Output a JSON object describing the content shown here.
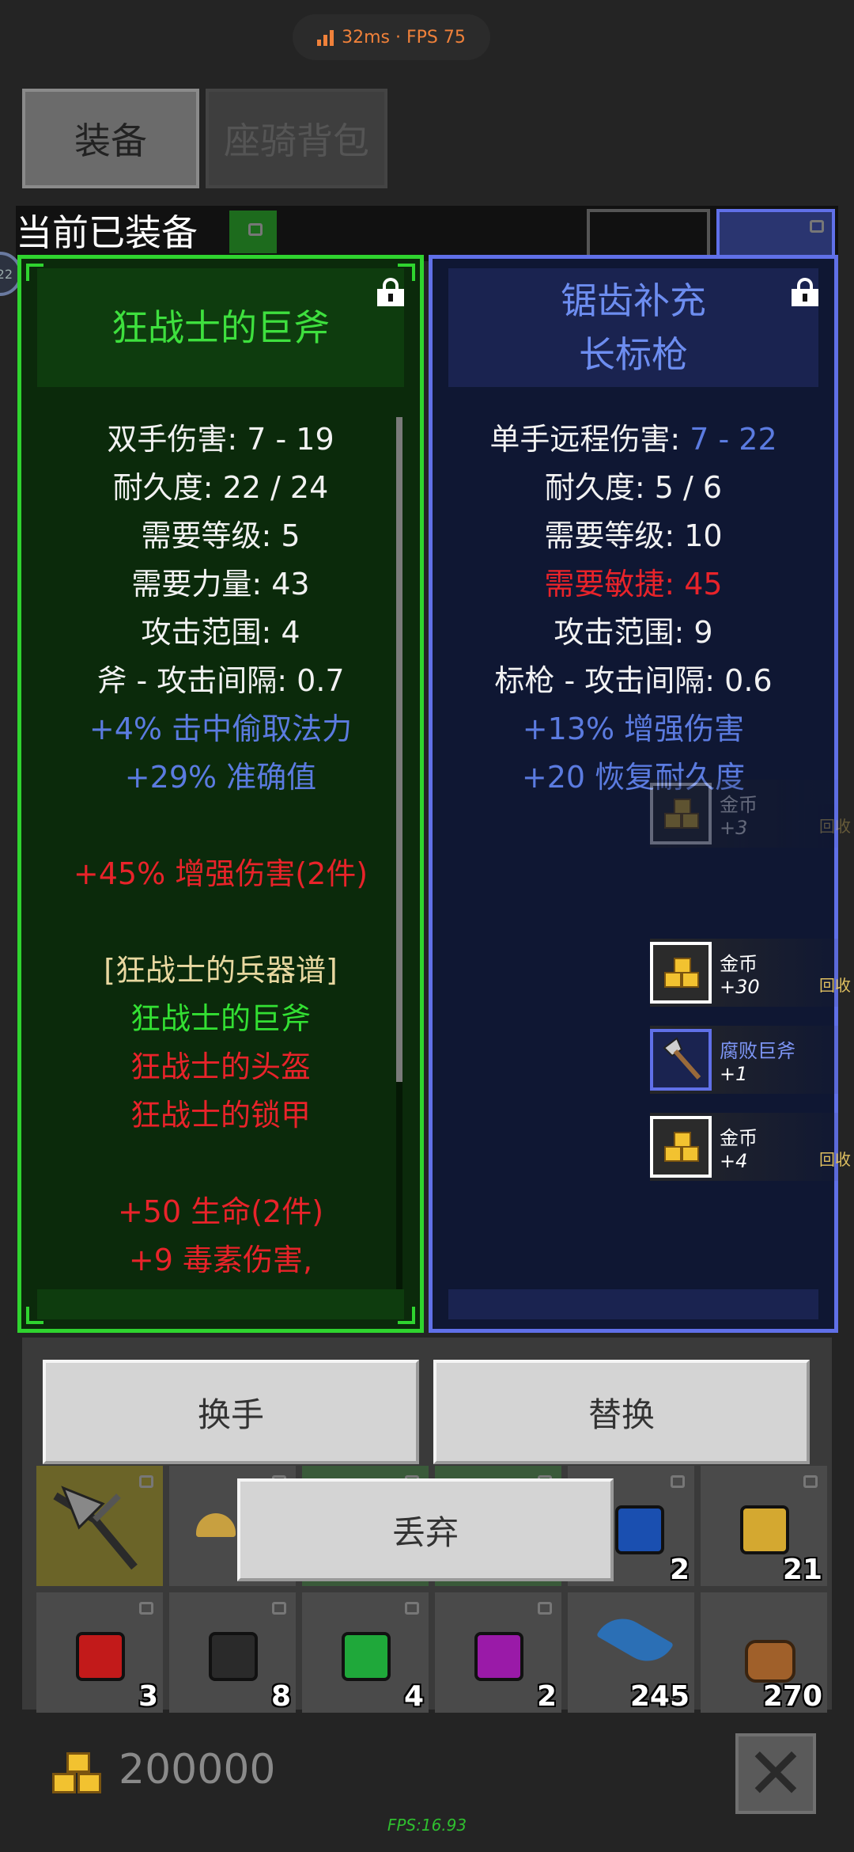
{
  "status": {
    "latency_fps": "32ms · FPS 75"
  },
  "tabs": [
    {
      "label": "装备"
    },
    {
      "label": "座骑背包"
    }
  ],
  "equipped_title": "当前已装备",
  "level_badge": "22",
  "left_item": {
    "name_lines": [
      "狂战士的巨斧"
    ],
    "color": "#2fd42f",
    "stats": [
      {
        "text": "双手伤害: 7 - 19",
        "color": "white"
      },
      {
        "text": "耐久度: 22 / 24",
        "color": "white"
      },
      {
        "text": "需要等级: 5",
        "color": "white"
      },
      {
        "text": "需要力量: 43",
        "color": "white"
      },
      {
        "text": "攻击范围: 4",
        "color": "white"
      },
      {
        "text": "斧 - 攻击间隔: 0.7",
        "color": "white"
      },
      {
        "text": "+4% 击中偷取法力",
        "color": "blue"
      },
      {
        "text": "+29% 准确值",
        "color": "blue"
      },
      {
        "text": "",
        "color": "white"
      },
      {
        "text": "+45% 增强伤害(2件)",
        "color": "red"
      },
      {
        "text": "",
        "color": "white"
      },
      {
        "text": "[狂战士的兵器谱]",
        "color": "yellow"
      },
      {
        "text": "狂战士的巨斧",
        "color": "green"
      },
      {
        "text": "狂战士的头盔",
        "color": "red"
      },
      {
        "text": "狂战士的锁甲",
        "color": "red"
      },
      {
        "text": "",
        "color": "white"
      },
      {
        "text": "+50 生命(2件)",
        "color": "red"
      },
      {
        "text": "+9 毒素伤害,",
        "color": "red"
      }
    ]
  },
  "right_item": {
    "name_lines": [
      "锯齿补充",
      "长标枪"
    ],
    "color": "#6070e8",
    "stat_damage_label": "单手远程伤害: ",
    "stat_damage_value": "7 - 22",
    "stats": [
      {
        "text": "耐久度: 5 / 6",
        "color": "white"
      },
      {
        "text": "需要等级: 10",
        "color": "white"
      },
      {
        "text": "需要敏捷: 45",
        "color": "red"
      },
      {
        "text": "攻击范围: 9",
        "color": "white"
      },
      {
        "text": "标枪 - 攻击间隔: 0.6",
        "color": "white"
      },
      {
        "text": "+13% 增强伤害",
        "color": "blue"
      },
      {
        "text": "+20 恢复耐久度",
        "color": "blue"
      }
    ]
  },
  "pickups": [
    {
      "name": "金币",
      "count": "+3",
      "recycle": "回收",
      "faded": true,
      "icon": "gold-coin-icon"
    },
    {
      "name": "金币",
      "count": "+30",
      "recycle": "回收",
      "faded": false,
      "icon": "gold-coin-icon"
    },
    {
      "name": "腐败巨斧",
      "count": "+1",
      "recycle": "",
      "faded": false,
      "icon": "axe-icon"
    },
    {
      "name": "金币",
      "count": "+4",
      "recycle": "回收",
      "faded": false,
      "icon": "gold-coin-icon"
    }
  ],
  "buttons": {
    "swap_hand": "换手",
    "replace": "替换",
    "discard": "丢弃"
  },
  "inventory": {
    "row1": [
      {
        "icon": "crossbow-icon",
        "count": ""
      },
      {
        "icon": "mushroom-icon",
        "count": ""
      },
      {
        "icon": "green-item-icon",
        "count": ""
      },
      {
        "icon": "green-item-icon",
        "count": ""
      },
      {
        "icon": "blue-gem-icon",
        "count": "2"
      },
      {
        "icon": "gold-gem-icon",
        "count": "21"
      }
    ],
    "row2": [
      {
        "icon": "red-gem-icon",
        "count": "3",
        "color": "#c21a1a"
      },
      {
        "icon": "black-gem-icon",
        "count": "8",
        "color": "#2a2a2a"
      },
      {
        "icon": "green-gem-icon",
        "count": "4",
        "color": "#1fa83a"
      },
      {
        "icon": "purple-gem-icon",
        "count": "2",
        "color": "#9a1aa8"
      },
      {
        "icon": "feather-icon",
        "count": "245",
        "color": "#2b6fb5"
      },
      {
        "icon": "ore-icon",
        "count": "270",
        "color": "#a0602a"
      }
    ]
  },
  "gold": "200000",
  "fps_footer": "FPS:16.93"
}
